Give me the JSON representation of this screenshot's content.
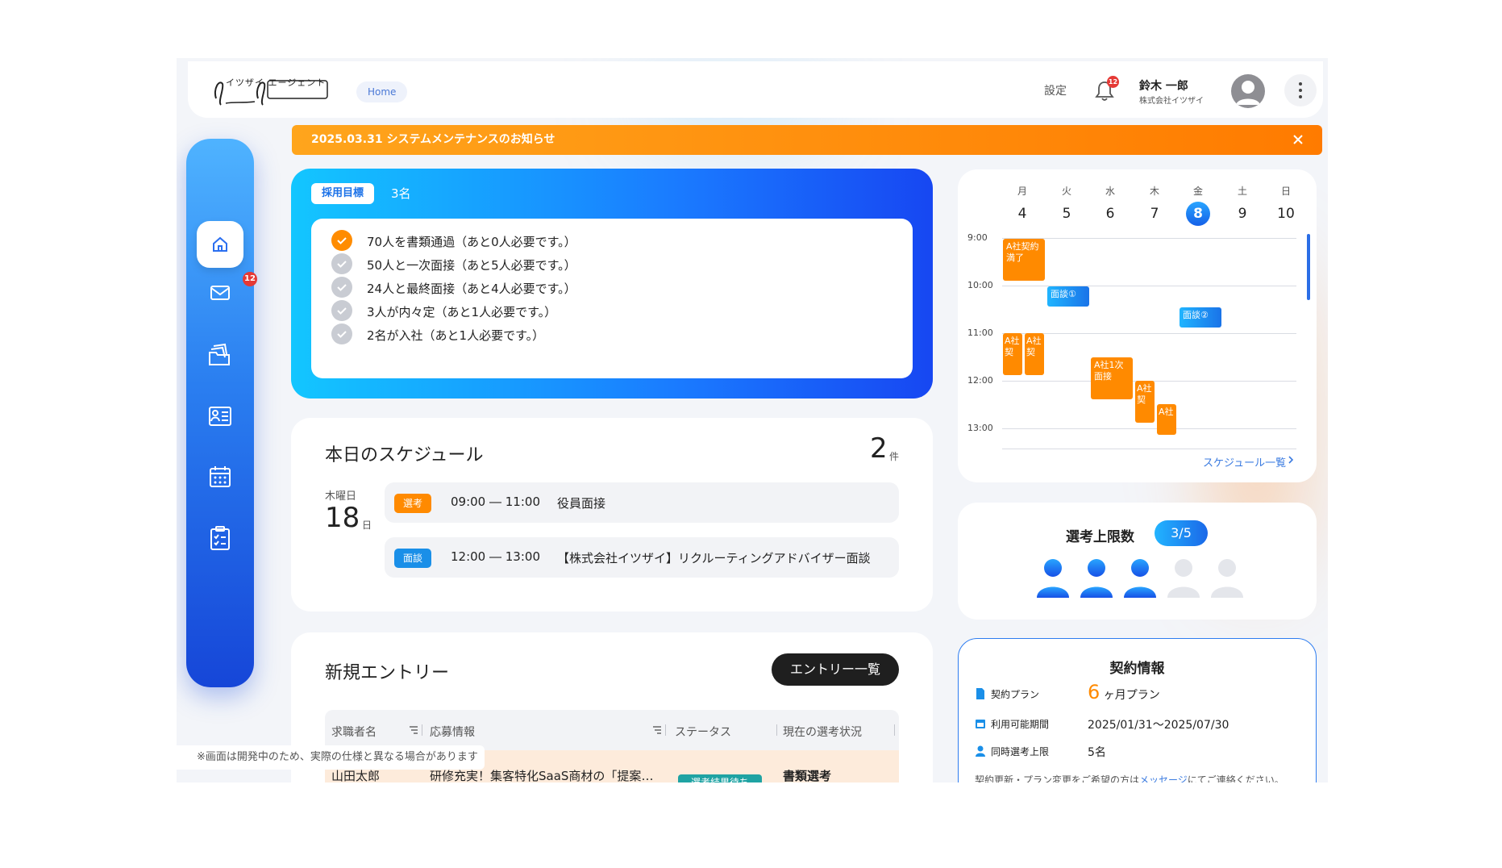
{
  "header": {
    "logo_text": "イツザイ エージェント",
    "breadcrumb": "Home",
    "settings_label": "設定",
    "notification_count": "12",
    "user_name": "鈴木 一郎",
    "user_company": "株式会社イツザイ"
  },
  "sidebar": {
    "items": [
      {
        "name": "home",
        "icon": "home-icon",
        "active": true
      },
      {
        "name": "messages",
        "icon": "mail-icon",
        "badge": "12"
      },
      {
        "name": "documents",
        "icon": "folder-icon"
      },
      {
        "name": "jobs",
        "icon": "profile-list-icon"
      },
      {
        "name": "calendar",
        "icon": "calendar-icon"
      },
      {
        "name": "tasks",
        "icon": "checklist-icon"
      }
    ]
  },
  "notice": {
    "text": "2025.03.31 システムメンテナンスのお知らせ"
  },
  "goals": {
    "tag": "採用目標",
    "count": "3名",
    "items": [
      {
        "text": "70人を書類通過（あと0人必要です。）",
        "done": true
      },
      {
        "text": "50人と一次面接（あと5人必要です。）",
        "done": false
      },
      {
        "text": "24人と最終面接（あと4人必要です。）",
        "done": false
      },
      {
        "text": "3人が内々定（あと1人必要です。）",
        "done": false
      },
      {
        "text": "2名が入社（あと1人必要です。）",
        "done": false
      }
    ]
  },
  "schedule": {
    "title": "本日のスケジュール",
    "count": "2",
    "count_unit": "件",
    "day_of_week": "木曜日",
    "day": "18",
    "day_unit": "日",
    "items": [
      {
        "badge": "選考",
        "color": "#ff8a00",
        "time": "09:00 ― 11:00",
        "text": "役員面接"
      },
      {
        "badge": "面談",
        "color": "#1a8fe8",
        "time": "12:00 ― 13:00",
        "text": "【株式会社イツザイ】リクルーティングアドバイザー面談"
      }
    ]
  },
  "entries": {
    "title": "新規エントリー",
    "list_button": "エントリー一覧",
    "columns": [
      "求職者名",
      "応募情報",
      "ステータス",
      "現在の選考状況"
    ],
    "rows": [
      {
        "name": "山田太郎",
        "job": "研修充実！集客特化SaaS商材の「提案営業」",
        "status": "選考結果待ち",
        "stage": "書類選考"
      }
    ]
  },
  "footer_note": "※画面は開発中のため、実際の仕様と異なる場合があります",
  "calendar": {
    "days": [
      {
        "dow": "月",
        "date": "4"
      },
      {
        "dow": "火",
        "date": "5"
      },
      {
        "dow": "水",
        "date": "6"
      },
      {
        "dow": "木",
        "date": "7"
      },
      {
        "dow": "金",
        "date": "8",
        "today": true
      },
      {
        "dow": "土",
        "date": "9"
      },
      {
        "dow": "日",
        "date": "10"
      }
    ],
    "hours": [
      "9:00",
      "10:00",
      "11:00",
      "12:00",
      "13:00"
    ],
    "events": [
      {
        "text": "A社契約満了",
        "color": "orange"
      },
      {
        "text": "面談①",
        "color": "blue"
      },
      {
        "text": "面談②",
        "color": "blue"
      },
      {
        "text": "A社契",
        "color": "orange"
      },
      {
        "text": "A社契",
        "color": "orange"
      },
      {
        "text": "A社1次面接",
        "color": "orange"
      },
      {
        "text": "A社契",
        "color": "orange"
      },
      {
        "text": "A社",
        "color": "orange"
      }
    ],
    "link": "スケジュール一覧"
  },
  "limit": {
    "label": "選考上限数",
    "value": "3/5",
    "used": 3,
    "total": 5
  },
  "contract": {
    "title": "契約情報",
    "plan_label": "契約プラン",
    "plan_months": "6",
    "plan_unit": "ヶ月プラン",
    "period_label": "利用可能期間",
    "period_value": "2025/01/31〜2025/07/30",
    "limit_label": "同時選考上限",
    "limit_value": "5名",
    "footer_pre": "契約更新・プラン変更をご希望の方は",
    "footer_link": "メッセージ",
    "footer_post": "にてご連絡ください。"
  },
  "colors": {
    "accent_blue": "#1a73e8",
    "accent_orange": "#ff8a00",
    "badge_red": "#e53935"
  }
}
